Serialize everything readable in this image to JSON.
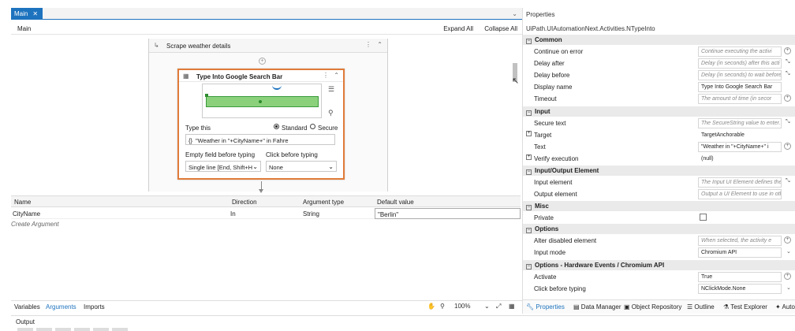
{
  "tab": {
    "label": "Main",
    "close": "✕"
  },
  "breadcrumb": {
    "label": "Main",
    "expand_all": "Expand All",
    "collapse_all": "Collapse All"
  },
  "sequence": {
    "title": "Scrape weather details"
  },
  "activity": {
    "title": "Type Into Google Search Bar",
    "type_this_label": "Type this",
    "radio_standard": "Standard",
    "radio_secure": "Secure",
    "text_value": "\"Weather in \"+CityName+\" in Fahre",
    "empty_field_label": "Empty field before typing",
    "empty_field_value": "Single line [End, Shift+H",
    "click_before_label": "Click before typing",
    "click_before_value": "None"
  },
  "arguments": {
    "headers": {
      "name": "Name",
      "direction": "Direction",
      "type": "Argument type",
      "default": "Default value"
    },
    "row": {
      "name": "CityName",
      "direction": "In",
      "type": "String",
      "default": "\"Berlin\""
    },
    "create": "Create Argument"
  },
  "bottom_tabs": {
    "variables": "Variables",
    "arguments": "Arguments",
    "imports": "Imports"
  },
  "zoom": {
    "value": "100%"
  },
  "output": {
    "label": "Output"
  },
  "properties": {
    "title": "Properties",
    "class_name": "UiPath.UIAutomationNext.Activities.NTypeInto",
    "cat_common": "Common",
    "continue_on_error": {
      "name": "Continue on error",
      "value": "Continue executing the activi"
    },
    "delay_after": {
      "name": "Delay after",
      "value": "Delay (in seconds) after this acti"
    },
    "delay_before": {
      "name": "Delay before",
      "value": "Delay (in seconds) to wait before"
    },
    "display_name": {
      "name": "Display name",
      "value": "Type Into Google Search Bar"
    },
    "timeout": {
      "name": "Timeout",
      "value": "The amount of time (in secor"
    },
    "cat_input": "Input",
    "secure_text": {
      "name": "Secure text",
      "value": "The SecureString value to enter."
    },
    "target": {
      "name": "Target",
      "value": "TargetAnchorable"
    },
    "text": {
      "name": "Text",
      "value": "\"Weather in \"+CityName+\" i"
    },
    "verify_execution": {
      "name": "Verify execution",
      "value": "(null)"
    },
    "cat_io": "Input/Output Element",
    "input_element": {
      "name": "Input element",
      "value": "The Input UI Element defines the"
    },
    "output_element": {
      "name": "Output element",
      "value": "Output a UI Element to use in other"
    },
    "cat_misc": "Misc",
    "private": {
      "name": "Private"
    },
    "cat_options": "Options",
    "alter_disabled": {
      "name": "Alter disabled element",
      "value": "When selected, the activity e"
    },
    "input_mode": {
      "name": "Input mode",
      "value": "Chromium API"
    },
    "cat_hw": "Options - Hardware Events / Chromium API",
    "activate": {
      "name": "Activate",
      "value": "True"
    },
    "click_before": {
      "name": "Click before typing",
      "value": "NClickMode.None"
    },
    "tabs": {
      "properties": "Properties",
      "data_manager": "Data Manager",
      "object_repository": "Object Repository",
      "outline": "Outline",
      "test_explorer": "Test Explorer",
      "auto": "Auto"
    }
  }
}
